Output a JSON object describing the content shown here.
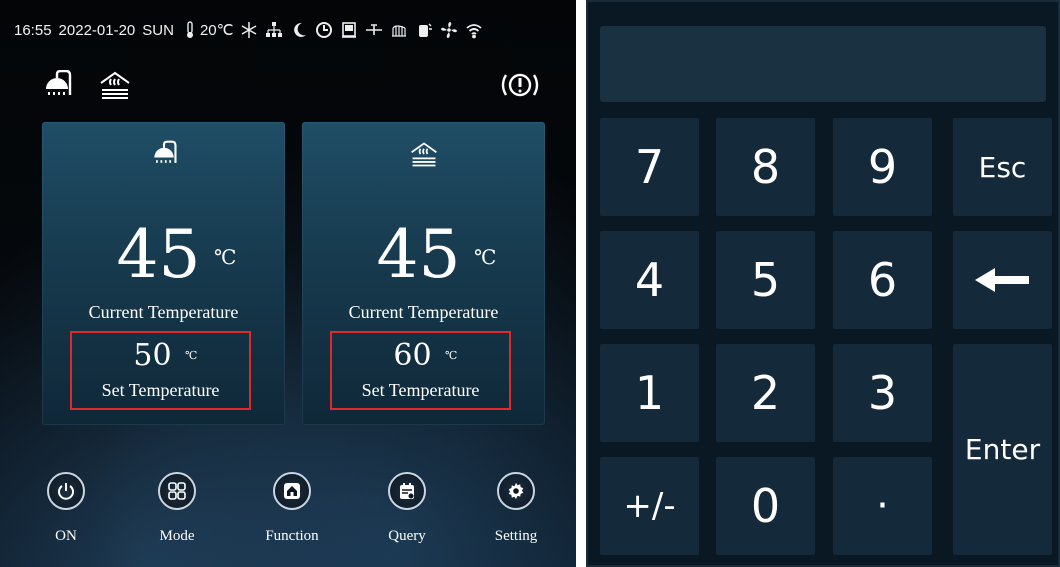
{
  "status_bar": {
    "time": "16:55",
    "date": "2022-01-20",
    "weekday": "SUN",
    "outdoor_temp": "20℃",
    "icons": [
      "thermometer-icon",
      "snowflake-icon",
      "network-icon",
      "moon-icon",
      "clock-icon",
      "unit-icon",
      "valve-icon",
      "heater-icon",
      "tank-icon",
      "fan-icon",
      "wifi-icon"
    ]
  },
  "top_icons": {
    "left": [
      "shower-icon",
      "floor-heating-icon"
    ],
    "right": "alarm-icon"
  },
  "cards": [
    {
      "icon": "shower-icon",
      "current_value": "45",
      "current_unit": "℃",
      "current_label": "Current Temperature",
      "set_value": "50",
      "set_unit": "℃",
      "set_label": "Set Temperature"
    },
    {
      "icon": "floor-heating-icon",
      "current_value": "45",
      "current_unit": "℃",
      "current_label": "Current Temperature",
      "set_value": "60",
      "set_unit": "℃",
      "set_label": "Set Temperature"
    }
  ],
  "nav": [
    {
      "label": "ON",
      "icon": "power-icon"
    },
    {
      "label": "Mode",
      "icon": "grid-icon"
    },
    {
      "label": "Function",
      "icon": "home-icon"
    },
    {
      "label": "Query",
      "icon": "calendar-icon"
    },
    {
      "label": "Setting",
      "icon": "gear-icon"
    }
  ],
  "keypad": {
    "display_value": "",
    "keys": {
      "k7": "7",
      "k8": "8",
      "k9": "9",
      "esc": "Esc",
      "k4": "4",
      "k5": "5",
      "k6": "6",
      "k1": "1",
      "k2": "2",
      "k3": "3",
      "sign": "+/-",
      "k0": "0",
      "dot": "·",
      "enter": "Enter"
    },
    "backspace_icon": "backspace-arrow-icon"
  },
  "colors": {
    "highlight_border": "#e0292a",
    "card_top": "#1f4e66",
    "key_bg": "#14293a",
    "keypad_bg": "#0a1824"
  }
}
